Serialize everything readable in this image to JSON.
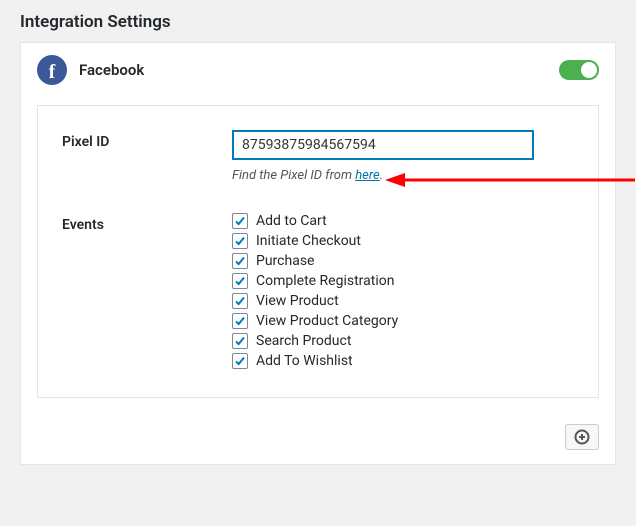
{
  "page_title": "Integration Settings",
  "integration": {
    "name": "Facebook",
    "icon_letter": "f",
    "enabled": true
  },
  "pixel": {
    "label": "Pixel ID",
    "value": "87593875984567594",
    "help_prefix": "Find the Pixel ID from ",
    "help_link_text": "here",
    "help_suffix": "."
  },
  "events": {
    "label": "Events",
    "items": [
      {
        "label": "Add to Cart",
        "checked": true
      },
      {
        "label": "Initiate Checkout",
        "checked": true
      },
      {
        "label": "Purchase",
        "checked": true
      },
      {
        "label": "Complete Registration",
        "checked": true
      },
      {
        "label": "View Product",
        "checked": true
      },
      {
        "label": "View Product Category",
        "checked": true
      },
      {
        "label": "Search Product",
        "checked": true
      },
      {
        "label": "Add To Wishlist",
        "checked": true
      }
    ]
  }
}
